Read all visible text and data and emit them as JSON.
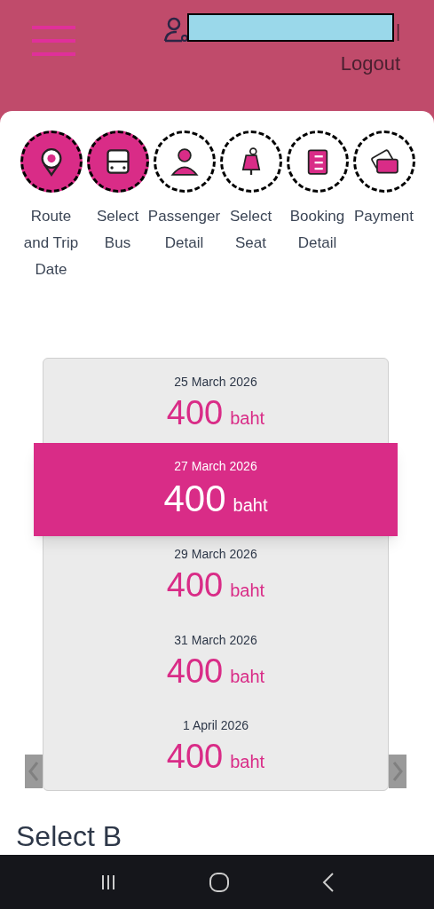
{
  "header": {
    "separator": "|",
    "logout": "Logout"
  },
  "steps": [
    {
      "label": "Route and Trip Date",
      "done": true
    },
    {
      "label": "Select Bus",
      "done": true
    },
    {
      "label": "Passenger Detail",
      "done": false
    },
    {
      "label": "Select Seat",
      "done": false
    },
    {
      "label": "Booking Detail",
      "done": false
    },
    {
      "label": "Payment",
      "done": false
    }
  ],
  "dates": [
    {
      "date": "25 March 2026",
      "price": "400",
      "unit": "baht",
      "selected": false
    },
    {
      "date": "27 March 2026",
      "price": "400",
      "unit": "baht",
      "selected": true
    },
    {
      "date": "29 March 2026",
      "price": "400",
      "unit": "baht",
      "selected": false
    },
    {
      "date": "31 March 2026",
      "price": "400",
      "unit": "baht",
      "selected": false
    },
    {
      "date": "1 April 2026",
      "price": "400",
      "unit": "baht",
      "selected": false
    }
  ],
  "section_heading": "Select B"
}
